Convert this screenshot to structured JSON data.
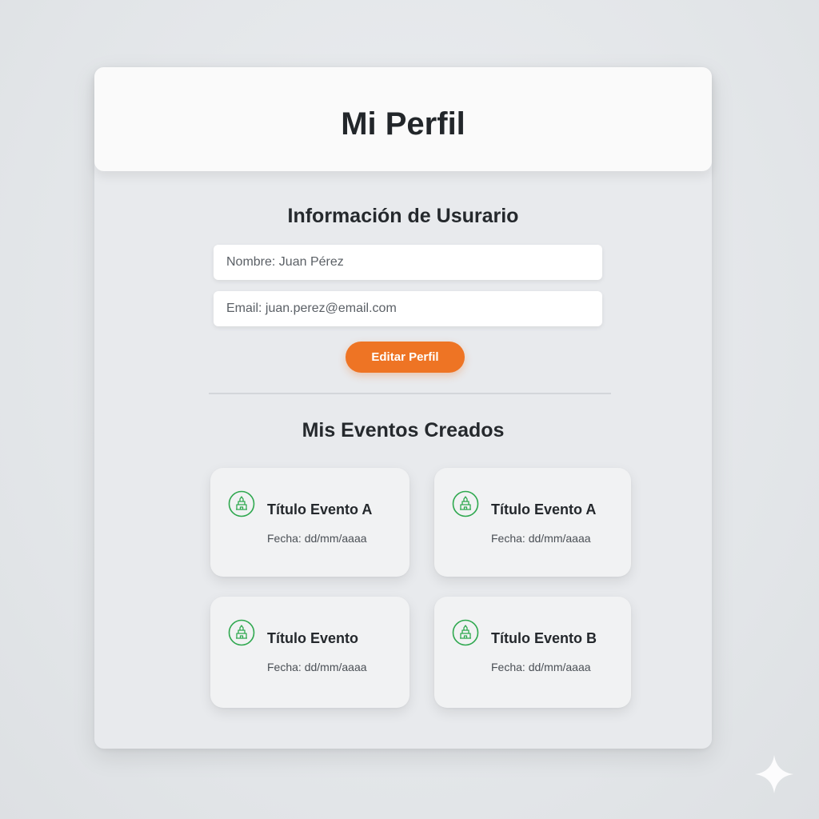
{
  "header": {
    "title": "Mi Perfil"
  },
  "user_info": {
    "title": "Información de Usurario",
    "name_field": {
      "value": "Nombre: Juan Pérez",
      "placeholder": "Nombre: Juan Pérez"
    },
    "email_field": {
      "value": "Email: juan.perez@email.com",
      "placeholder": "Email: juan.perez@email.com"
    },
    "edit_button": "Editar Perfil"
  },
  "events": {
    "title": "Mis Eventos Creados",
    "items": [
      {
        "title": "Título Evento A",
        "date": "Fecha: dd/mm/aaaa",
        "icon": "event-venue-icon"
      },
      {
        "title": "Título Evento A",
        "date": "Fecha: dd/mm/aaaa",
        "icon": "event-venue-icon"
      },
      {
        "title": "Título Evento",
        "date": "Fecha: dd/mm/aaaa",
        "icon": "event-venue-icon"
      },
      {
        "title": "Título Evento B",
        "date": "Fecha: dd/mm/aaaa",
        "icon": "event-venue-icon"
      }
    ]
  },
  "colors": {
    "accent": "#ee7424",
    "icon_green": "#2fa84f",
    "background": "#e4e7ea",
    "card": "#e8eaed",
    "header": "#fafafa"
  }
}
